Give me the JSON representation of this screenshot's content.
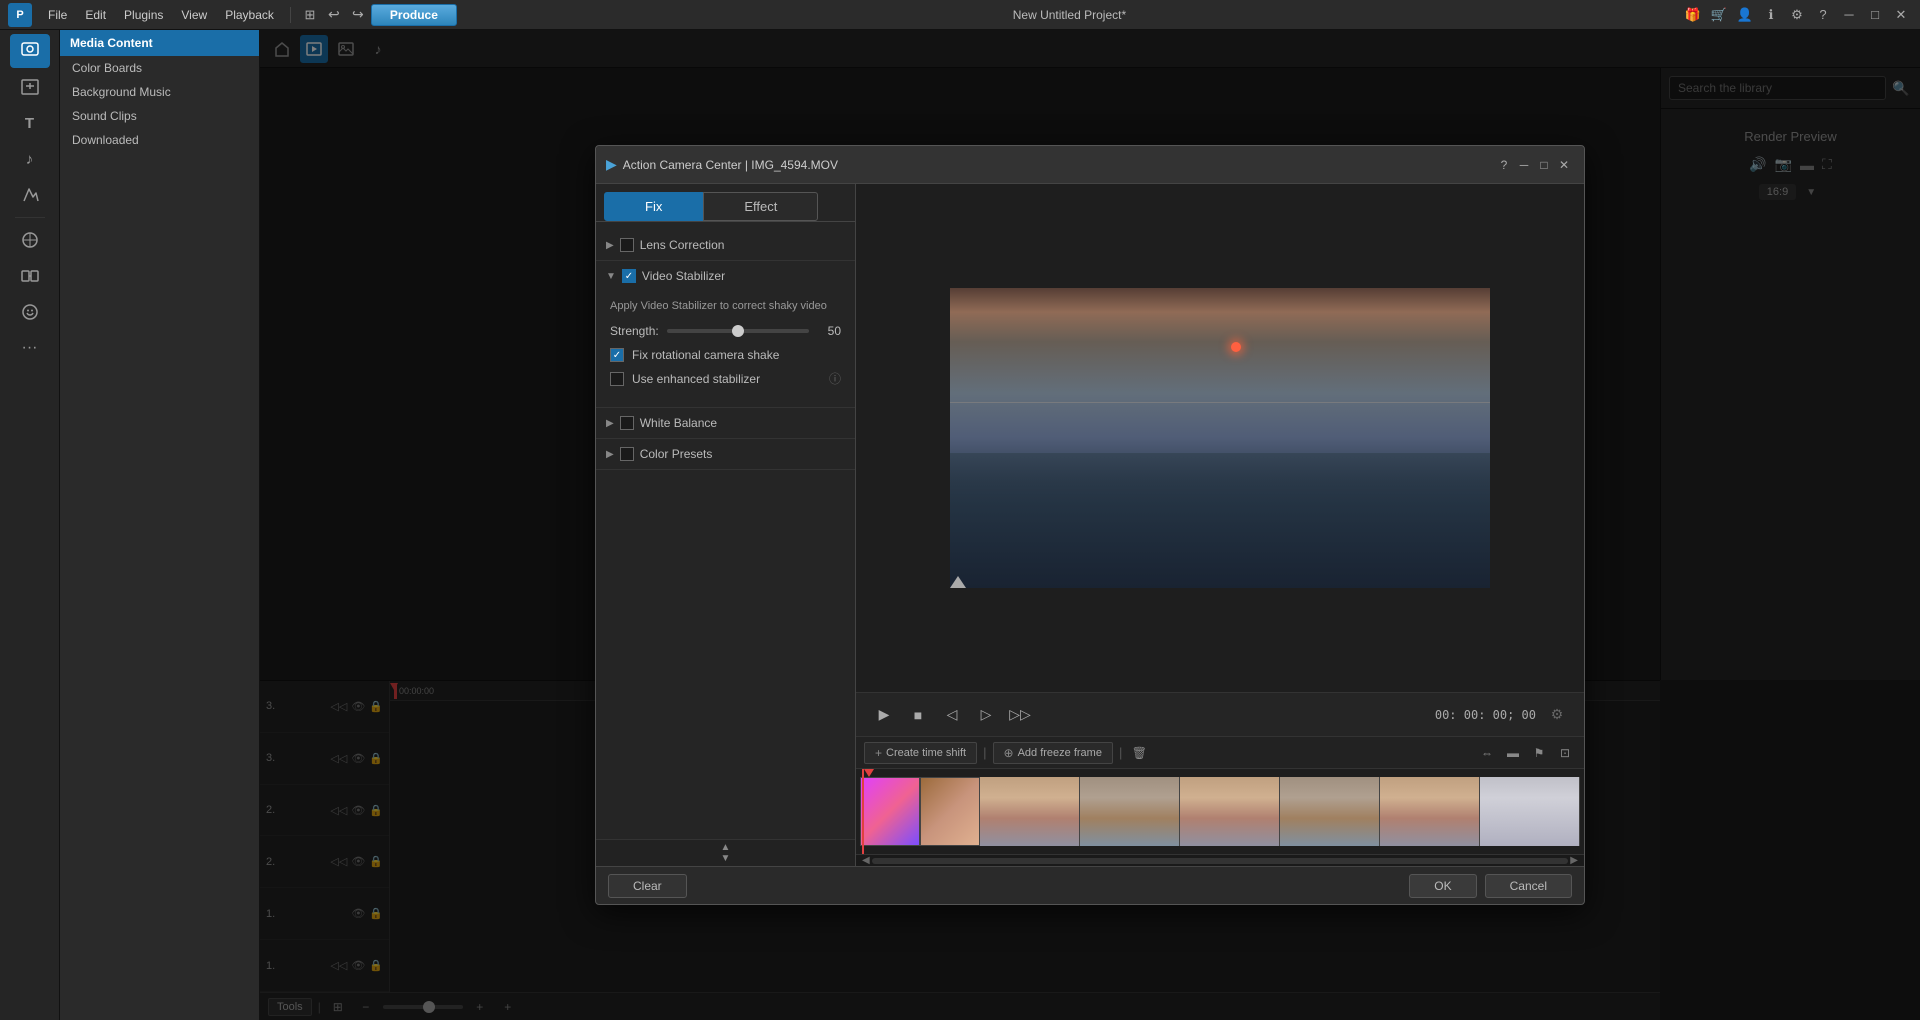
{
  "app": {
    "title": "New Untitled Project*",
    "logo": "P"
  },
  "menu": {
    "items": [
      "File",
      "Edit",
      "Plugins",
      "View",
      "Playback"
    ],
    "produce_label": "Produce"
  },
  "sidebar": {
    "header": "Media Content",
    "items": [
      {
        "label": "Color Boards"
      },
      {
        "label": "Background Music"
      },
      {
        "label": "Sound Clips"
      },
      {
        "label": "Downloaded"
      }
    ]
  },
  "search": {
    "placeholder": "Search the library"
  },
  "modal": {
    "title": "Action Camera Center | IMG_4594.MOV",
    "tabs": [
      {
        "label": "Fix",
        "active": true
      },
      {
        "label": "Effect",
        "active": false
      }
    ],
    "sections": {
      "lens_correction": {
        "label": "Lens Correction",
        "expanded": false,
        "checked": false
      },
      "video_stabilizer": {
        "label": "Video Stabilizer",
        "expanded": true,
        "checked": true,
        "description": "Apply Video Stabilizer to correct shaky video",
        "strength_label": "Strength:",
        "strength_value": "50",
        "fix_rotational_label": "Fix rotational camera shake",
        "fix_rotational_checked": true,
        "enhanced_label": "Use enhanced stabilizer",
        "enhanced_checked": false
      },
      "white_balance": {
        "label": "White Balance",
        "expanded": false,
        "checked": false
      },
      "color_presets": {
        "label": "Color Presets",
        "expanded": false,
        "checked": false
      }
    },
    "playback": {
      "time": "00: 00: 00; 00"
    },
    "timeline": {
      "create_time_shift": "Create time shift",
      "add_freeze_frame": "Add freeze frame"
    },
    "footer": {
      "clear_label": "Clear",
      "ok_label": "OK",
      "cancel_label": "Cancel"
    }
  },
  "render_preview": {
    "label": "Render Preview",
    "ratio": "16:9"
  },
  "track_labels": [
    {
      "id": "3.",
      "show": true,
      "lock": true
    },
    {
      "id": "3.",
      "show": true,
      "lock": true
    },
    {
      "id": "2.",
      "show": true,
      "lock": true
    },
    {
      "id": "2.",
      "show": true,
      "lock": true
    },
    {
      "id": "1.",
      "show": true,
      "lock": true
    },
    {
      "id": "1.",
      "show": true,
      "lock": true
    }
  ],
  "timeline_ruler_time": "00:00:00"
}
